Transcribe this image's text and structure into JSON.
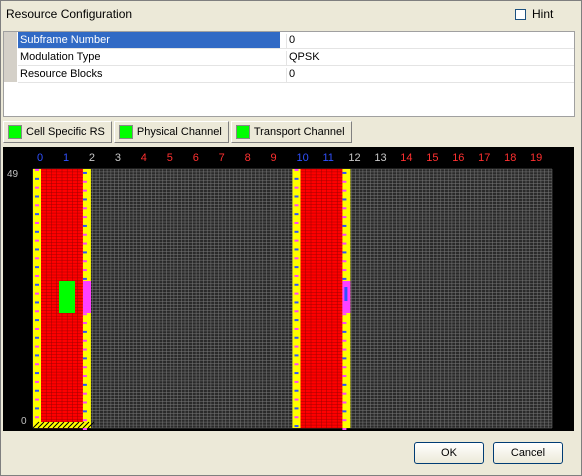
{
  "window": {
    "title": "Resource Configuration"
  },
  "hint": {
    "label": "Hint",
    "checked": false
  },
  "properties": [
    {
      "name": "Subframe Number",
      "value": "0",
      "selected": true
    },
    {
      "name": "Modulation Type",
      "value": "QPSK",
      "selected": false
    },
    {
      "name": "Resource Blocks",
      "value": "0",
      "selected": false
    }
  ],
  "tabs": [
    {
      "label": "Cell Specific RS",
      "swatch": "#00ff00"
    },
    {
      "label": "Physical Channel",
      "swatch": "#00ff00"
    },
    {
      "label": "Transport Channel",
      "swatch": "#00ff00"
    }
  ],
  "grid": {
    "slots": [
      "0",
      "1",
      "2",
      "3",
      "4",
      "5",
      "6",
      "7",
      "8",
      "9",
      "10",
      "11",
      "12",
      "13",
      "14",
      "15",
      "16",
      "17",
      "18",
      "19"
    ],
    "slot_colors": {
      "blue": "#3050ff",
      "gray": "#c8c8c8",
      "red": "#ff3030"
    },
    "y_labels": {
      "top": "49",
      "bottom": "0"
    },
    "colors": {
      "background": "#000000",
      "grid_line": "#7a7a7a",
      "rs": "#ffff00",
      "pdsch": "#ff0000",
      "highlight": "#00ff00",
      "marker_blue": "#3050ff",
      "marker_magenta": "#ff40ff"
    }
  },
  "buttons": {
    "ok": "OK",
    "cancel": "Cancel"
  }
}
